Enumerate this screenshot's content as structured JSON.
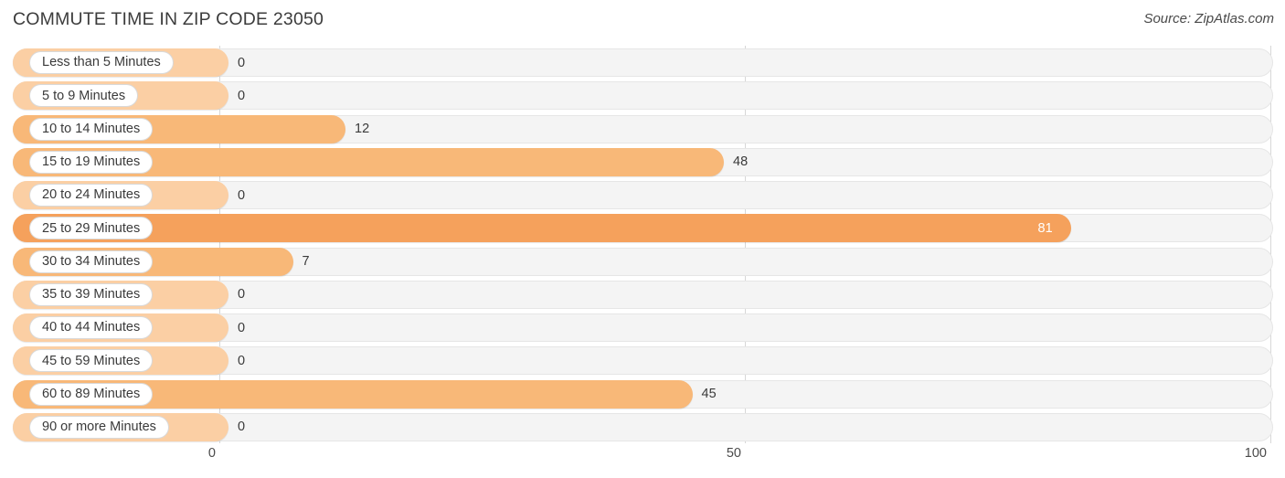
{
  "header": {
    "title": "COMMUTE TIME IN ZIP CODE 23050",
    "source": "Source: ZipAtlas.com"
  },
  "colors": {
    "bar_light": "#fbcfa4",
    "bar_mid": "#f8b878",
    "bar_strong": "#f5a15c",
    "track": "#f4f4f4",
    "gridline": "#d7d7d7",
    "text": "#3a3a3a"
  },
  "axis": {
    "ticks": [
      {
        "label": "0",
        "value": 0
      },
      {
        "label": "50",
        "value": 50
      },
      {
        "label": "100",
        "value": 100
      }
    ]
  },
  "chart_data": {
    "type": "bar",
    "orientation": "horizontal",
    "title": "COMMUTE TIME IN ZIP CODE 23050",
    "xlabel": "",
    "ylabel": "",
    "xlim": [
      0,
      100
    ],
    "grid": true,
    "legend": null,
    "source": "Source: ZipAtlas.com",
    "categories": [
      "Less than 5 Minutes",
      "5 to 9 Minutes",
      "10 to 14 Minutes",
      "15 to 19 Minutes",
      "20 to 24 Minutes",
      "25 to 29 Minutes",
      "30 to 34 Minutes",
      "35 to 39 Minutes",
      "40 to 44 Minutes",
      "45 to 59 Minutes",
      "60 to 89 Minutes",
      "90 or more Minutes"
    ],
    "values": [
      0,
      0,
      12,
      48,
      0,
      81,
      7,
      0,
      0,
      0,
      45,
      0
    ],
    "value_labels": [
      "0",
      "0",
      "12",
      "48",
      "0",
      "81",
      "7",
      "0",
      "0",
      "0",
      "45",
      "0"
    ]
  },
  "rows": [
    {
      "label": "Less than 5 Minutes",
      "value": 0,
      "value_label": "0",
      "tone": "light",
      "inside": false
    },
    {
      "label": "5 to 9 Minutes",
      "value": 0,
      "value_label": "0",
      "tone": "light",
      "inside": false
    },
    {
      "label": "10 to 14 Minutes",
      "value": 12,
      "value_label": "12",
      "tone": "mid",
      "inside": false
    },
    {
      "label": "15 to 19 Minutes",
      "value": 48,
      "value_label": "48",
      "tone": "mid",
      "inside": false
    },
    {
      "label": "20 to 24 Minutes",
      "value": 0,
      "value_label": "0",
      "tone": "light",
      "inside": false
    },
    {
      "label": "25 to 29 Minutes",
      "value": 81,
      "value_label": "81",
      "tone": "strong",
      "inside": true
    },
    {
      "label": "30 to 34 Minutes",
      "value": 7,
      "value_label": "7",
      "tone": "mid",
      "inside": false
    },
    {
      "label": "35 to 39 Minutes",
      "value": 0,
      "value_label": "0",
      "tone": "light",
      "inside": false
    },
    {
      "label": "40 to 44 Minutes",
      "value": 0,
      "value_label": "0",
      "tone": "light",
      "inside": false
    },
    {
      "label": "45 to 59 Minutes",
      "value": 0,
      "value_label": "0",
      "tone": "light",
      "inside": false
    },
    {
      "label": "60 to 89 Minutes",
      "value": 45,
      "value_label": "45",
      "tone": "mid",
      "inside": false
    },
    {
      "label": "90 or more Minutes",
      "value": 0,
      "value_label": "0",
      "tone": "light",
      "inside": false
    }
  ]
}
